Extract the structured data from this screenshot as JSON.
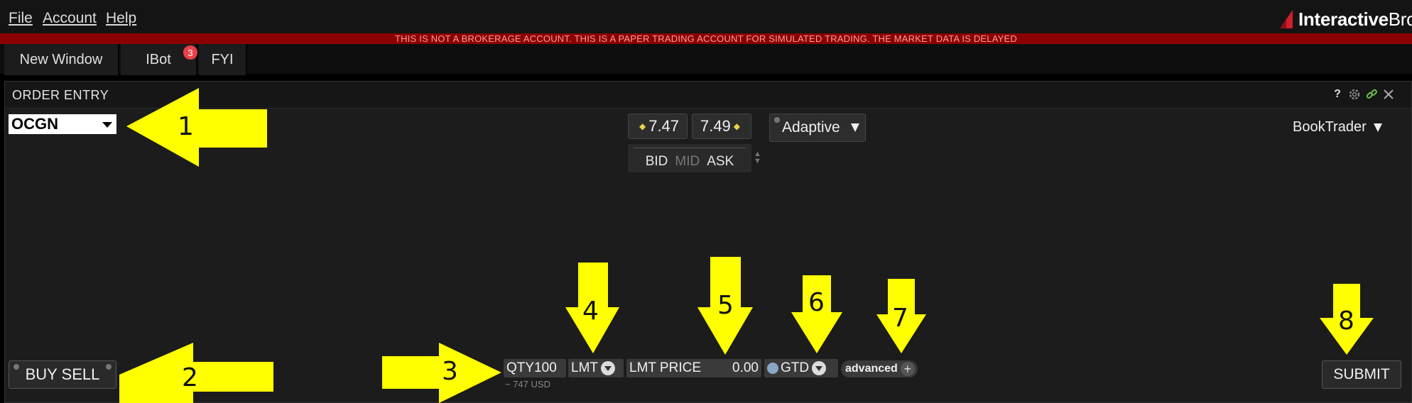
{
  "menu": {
    "file": "File",
    "account": "Account",
    "help": "Help"
  },
  "brand": {
    "bold": "Interactive",
    "normal": "Bro"
  },
  "warning_text": "THIS IS NOT A BROKERAGE ACCOUNT. THIS IS A PAPER TRADING ACCOUNT FOR SIMULATED TRADING. THE MARKET DATA IS DELAYED",
  "tabs": [
    {
      "label": "New Window"
    },
    {
      "label": "IBot",
      "badge": "3"
    },
    {
      "label": "FYI"
    }
  ],
  "panel": {
    "title": "ORDER ENTRY",
    "help_icon": "?",
    "icons": [
      "help-icon",
      "gear-icon",
      "link-icon",
      "close-icon"
    ]
  },
  "symbol": "OCGN",
  "quote": {
    "bid": "7.47",
    "ask": "7.49",
    "labels": {
      "bid": "BID",
      "mid": "MID",
      "ask": "ASK"
    }
  },
  "algo": "Adaptive",
  "booktrader": "BookTrader",
  "order": {
    "side_label": "BUY SELL",
    "qty_label": "QTY",
    "qty_value": "100",
    "notional": "~ 747 USD",
    "order_type": "LMT",
    "lmt_price_label": "LMT PRICE",
    "lmt_price_value": "0.00",
    "tif": "GTD",
    "advanced_label": "advanced",
    "submit_label": "SUBMIT"
  },
  "annotations": [
    "1",
    "2",
    "3",
    "4",
    "5",
    "6",
    "7",
    "8"
  ],
  "colors": {
    "annotation_yellow": "#ffff00",
    "warning_red": "#8b0000",
    "badge_red": "#e8414a"
  }
}
